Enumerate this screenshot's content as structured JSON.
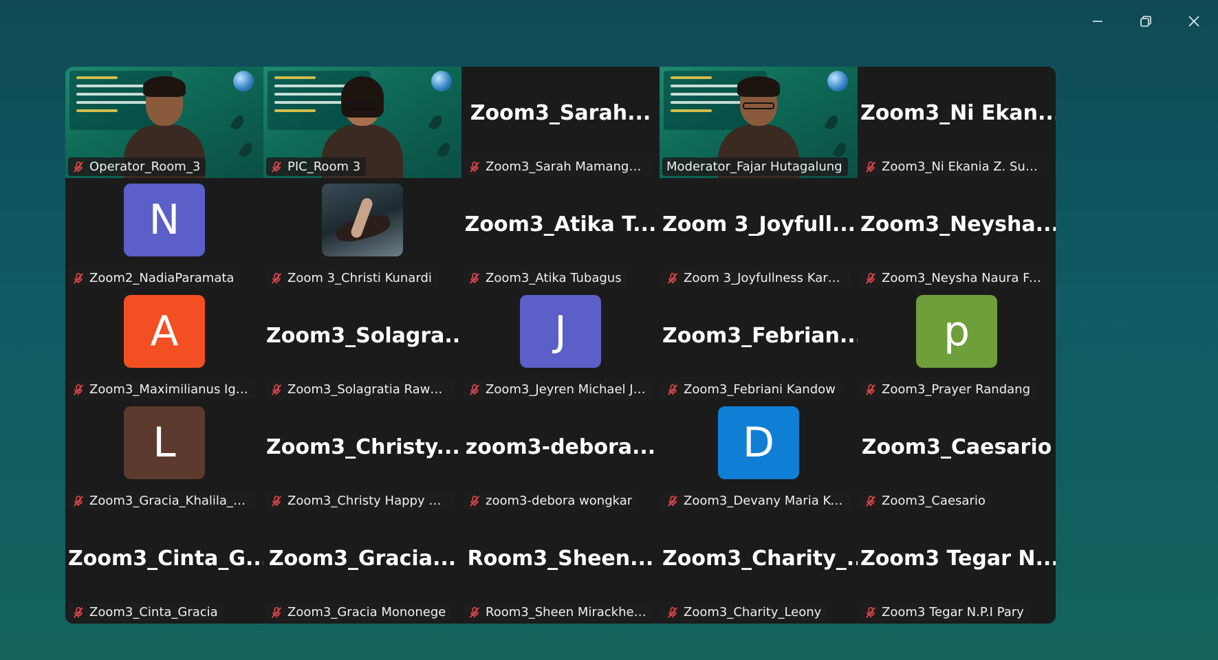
{
  "window": {
    "controls": [
      "minimize-icon",
      "restore-icon",
      "close-icon"
    ]
  },
  "colors": {
    "background": "#0f5a64",
    "grid": "#1b1b1b",
    "speaking_border": "#3ddc84",
    "mute_icon": "#e5484d"
  },
  "participants": [
    {
      "label": "Operator_Room_3",
      "muted": true,
      "video": true
    },
    {
      "label": "PIC_Room 3",
      "muted": true,
      "video": true,
      "glasses": true,
      "female": true
    },
    {
      "label": "Zoom3_Sarah Mamangkey",
      "muted": true,
      "big_name": "Zoom3_Sarah..."
    },
    {
      "label": "Moderator_Fajar Hutagalung",
      "muted": false,
      "video": true,
      "speaking": true,
      "glasses": true
    },
    {
      "label": "Zoom3_Ni Ekania Z. Sukanta",
      "muted": true,
      "big_name": "Zoom3_Ni  Ekan..."
    },
    {
      "label": "Zoom2_NadiaParamata",
      "muted": true,
      "avatar": "N",
      "avatar_color": "#5b5fc7"
    },
    {
      "label": "Zoom 3_Christi Kunardi",
      "muted": true,
      "avatar_photo": true
    },
    {
      "label": "Zoom3_Atika Tubagus",
      "muted": true,
      "big_name": "Zoom3_Atika  T..."
    },
    {
      "label": "Zoom 3_Joyfullness Karunde...",
      "muted": true,
      "big_name": "Zoom  3_Joyfull..."
    },
    {
      "label": "Zoom3_Neysha Naura Fatta ...",
      "muted": true,
      "big_name": "Zoom3_Neysha..."
    },
    {
      "label": "Zoom3_Maximilianus Ignati...",
      "muted": true,
      "avatar": "A",
      "avatar_color": "#f25022"
    },
    {
      "label": "Zoom3_Solagratia Rawung",
      "muted": true,
      "big_name": "Zoom3_Solagra..."
    },
    {
      "label": "Zoom3_Jeyren Michael Josu...",
      "muted": true,
      "avatar": "J",
      "avatar_color": "#5b5fc7"
    },
    {
      "label": "Zoom3_Febriani Kandow",
      "muted": true,
      "big_name": "Zoom3_Febrian..."
    },
    {
      "label": "Zoom3_Prayer Randang",
      "muted": true,
      "avatar": "p",
      "avatar_color": "#6e9f3a"
    },
    {
      "label": "Zoom3_Gracia_Khalila_Lutfi...",
      "muted": true,
      "avatar": "L",
      "avatar_color": "#5c3b2e"
    },
    {
      "label": "Zoom3_Christy Happy Weol",
      "muted": true,
      "big_name": "Zoom3_Christy..."
    },
    {
      "label": "zoom3-debora wongkar",
      "muted": true,
      "big_name": "zoom3-debora..."
    },
    {
      "label": "Zoom3_Devany Maria Kojon...",
      "muted": true,
      "avatar": "D",
      "avatar_color": "#0f7fd6"
    },
    {
      "label": "Zoom3_Caesario",
      "muted": true,
      "big_name": "Zoom3_Caesario"
    },
    {
      "label": "Zoom3_Cinta_Gracia",
      "muted": true,
      "big_name": "Zoom3_Cinta_G..."
    },
    {
      "label": "Zoom3_Gracia Mononege",
      "muted": true,
      "big_name": "Zoom3_Gracia..."
    },
    {
      "label": "Room3_Sheen Mirackhel Bu...",
      "muted": true,
      "big_name": "Room3_Sheen..."
    },
    {
      "label": "Zoom3_Charity_Leony",
      "muted": true,
      "big_name": "Zoom3_Charity_..."
    },
    {
      "label": "Zoom3 Tegar N.P.I Pary",
      "muted": true,
      "big_name": "Zoom3  Tegar  N...."
    }
  ]
}
